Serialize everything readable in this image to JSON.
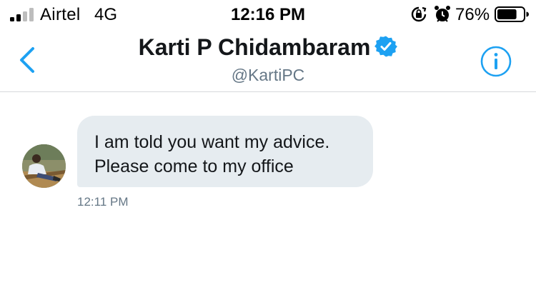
{
  "status_bar": {
    "carrier": "Airtel",
    "network": "4G",
    "time": "12:16 PM",
    "battery_percent": "76%",
    "battery_level": 0.76,
    "signal_bars_filled": 2,
    "signal_bars_total": 4,
    "icons": [
      "signal-icon",
      "rotation-lock-icon",
      "alarm-icon",
      "battery-icon"
    ]
  },
  "header": {
    "title": "Karti P Chidambaram",
    "handle": "@KartiPC",
    "verified": true,
    "back_icon": "chevron-left-icon",
    "info_icon": "info-icon"
  },
  "conversation": {
    "messages": [
      {
        "lines": [
          "I am told you want my advice.",
          "Please come to my office"
        ],
        "time": "12:11 PM"
      }
    ]
  },
  "colors": {
    "accent": "#1da1f2",
    "bubble": "#e6ecf0",
    "secondary_text": "#657786",
    "primary_text": "#14171a"
  }
}
